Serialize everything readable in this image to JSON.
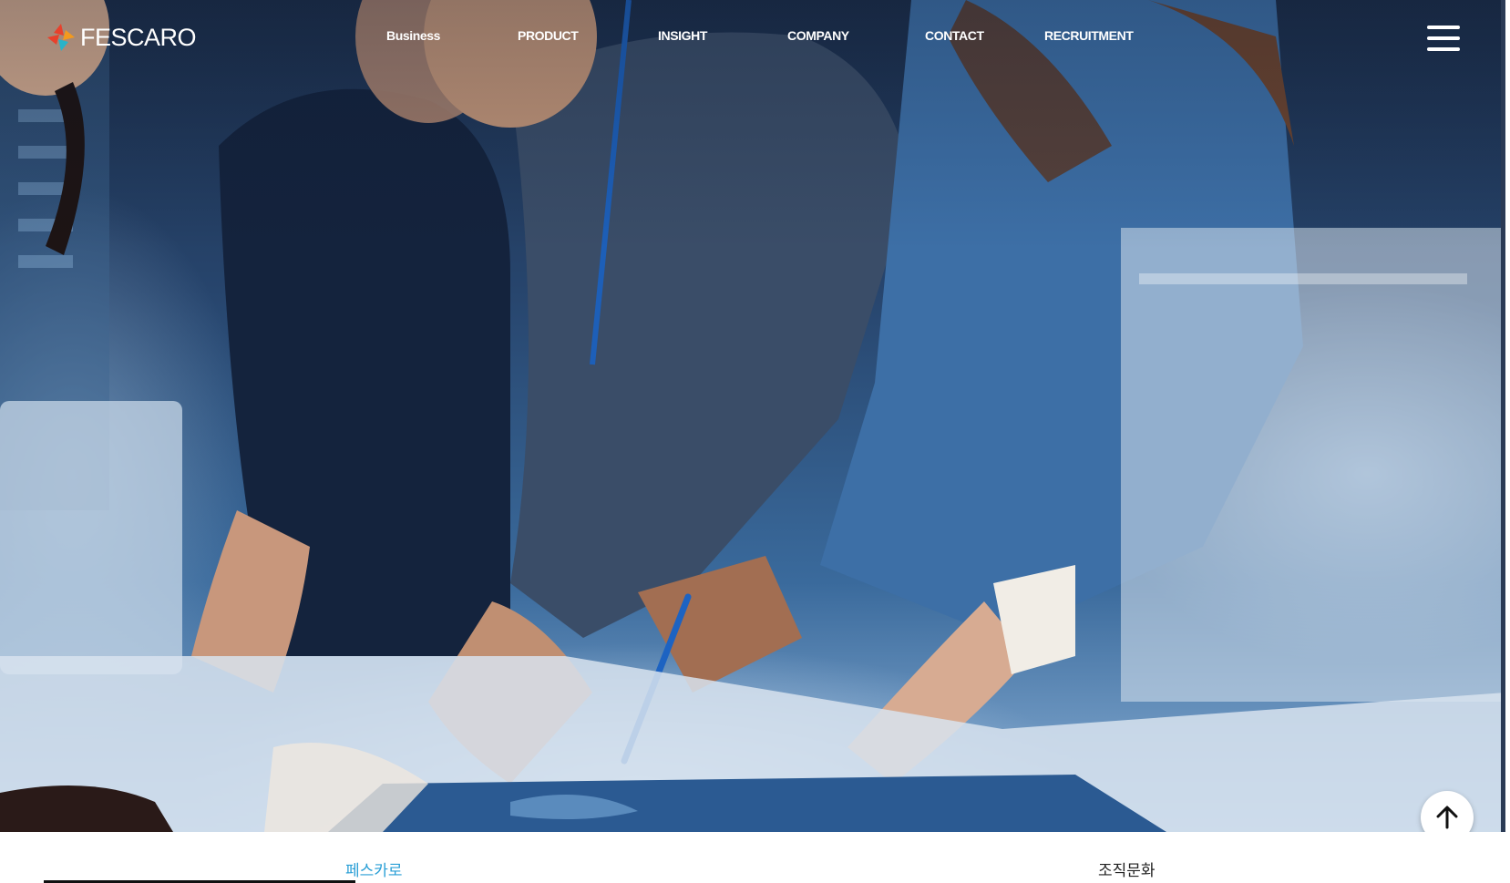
{
  "header": {
    "logo_text": "FESCARO",
    "nav": [
      {
        "label": "Business"
      },
      {
        "label": "PRODUCT"
      },
      {
        "label": "INSIGHT"
      },
      {
        "label": "COMPANY"
      },
      {
        "label": "CONTACT"
      },
      {
        "label": "RECRUITMENT"
      }
    ],
    "menu_icon": "hamburger-icon"
  },
  "tabs": [
    {
      "label": "페스카로",
      "active": true
    },
    {
      "label": "조직문화",
      "active": false
    }
  ],
  "floating": {
    "scroll_top_icon": "arrow-up-icon"
  },
  "colors": {
    "accent": "#2a9fd6",
    "logo_red": "#e8412c",
    "logo_orange": "#f39a1e",
    "logo_teal": "#2ab3c8"
  }
}
